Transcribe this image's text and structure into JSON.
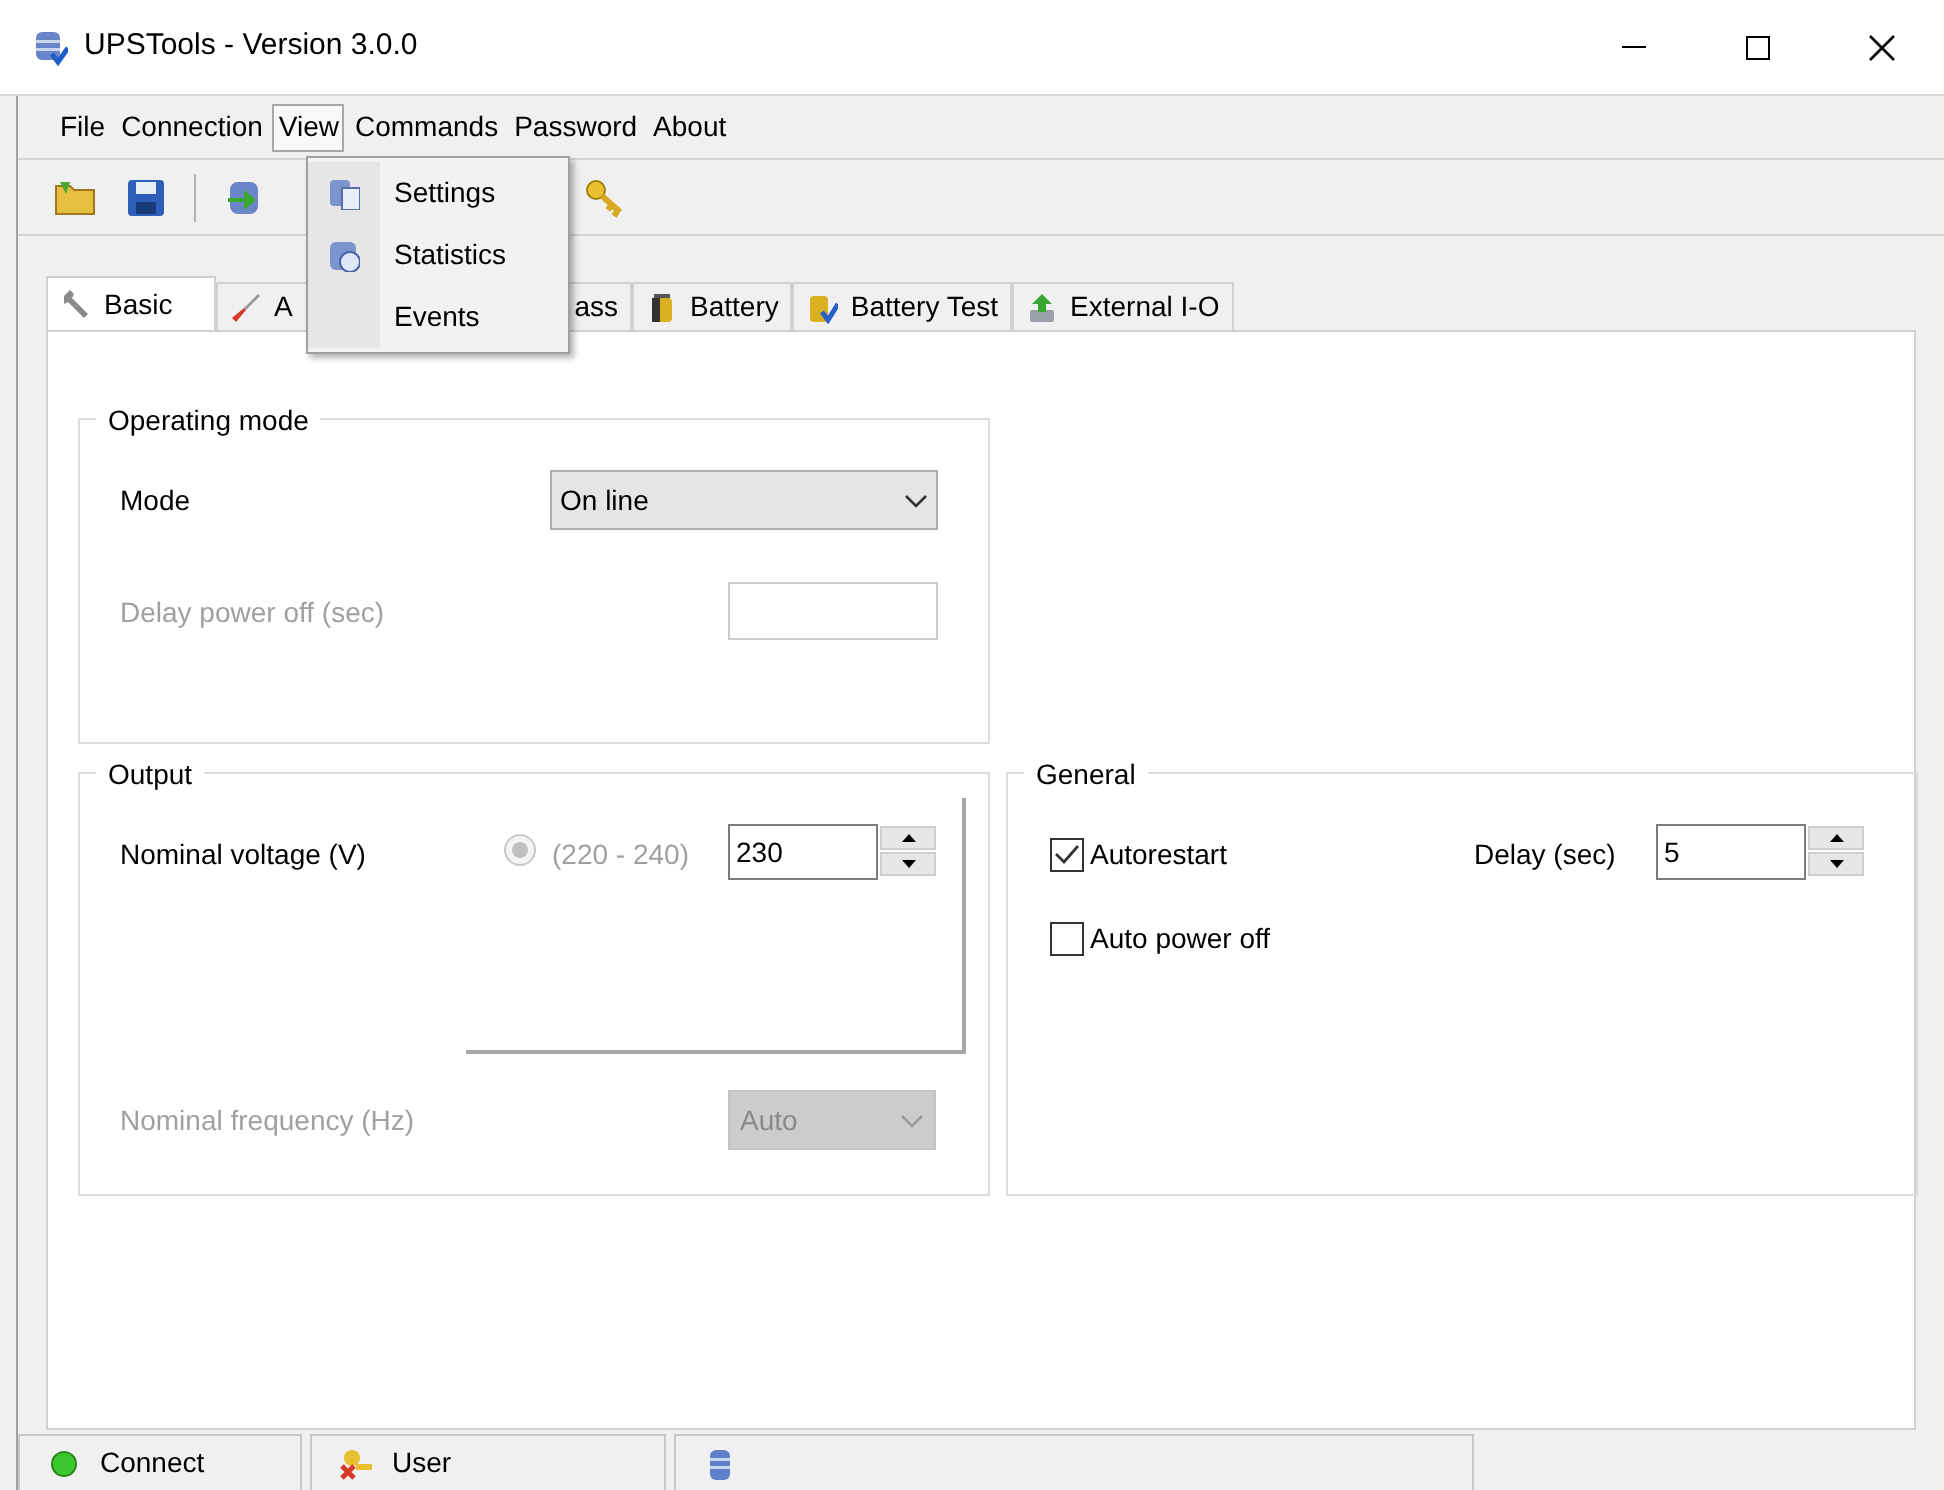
{
  "window": {
    "title": "UPSTools - Version 3.0.0"
  },
  "menu": [
    {
      "label": "File",
      "selected": false
    },
    {
      "label": "Connection",
      "selected": false
    },
    {
      "label": "View",
      "selected": true
    },
    {
      "label": "Commands",
      "selected": false
    },
    {
      "label": "Password",
      "selected": false
    },
    {
      "label": "About",
      "selected": false
    }
  ],
  "view_menu": [
    "Settings",
    "Statistics",
    "Events"
  ],
  "tabs": [
    {
      "label": "Basic",
      "selected": true
    },
    {
      "label": "A",
      "selected": false
    },
    {
      "label": "ass",
      "selected": false
    },
    {
      "label": "Battery",
      "selected": false
    },
    {
      "label": "Battery Test",
      "selected": false
    },
    {
      "label": "External I-O",
      "selected": false
    }
  ],
  "operating_mode": {
    "title": "Operating mode",
    "mode_label": "Mode",
    "mode_value": "On line",
    "delay_label": "Delay power off (sec)",
    "delay_disabled": true
  },
  "output": {
    "title": "Output",
    "voltage_label": "Nominal voltage (V)",
    "radio_label": "(220 - 240)",
    "radio_selected": true,
    "radio_disabled": true,
    "voltage_value": "230",
    "frequency_label": "Nominal frequency (Hz)",
    "frequency_value": "Auto",
    "frequency_disabled": true
  },
  "general": {
    "title": "General",
    "autorestart": {
      "label": "Autorestart",
      "checked": true
    },
    "auto_power_off": {
      "label": "Auto power off",
      "checked": false
    },
    "delay_label": "Delay (sec)",
    "delay_value": "5"
  },
  "status_bar": [
    "Connect",
    "User"
  ]
}
